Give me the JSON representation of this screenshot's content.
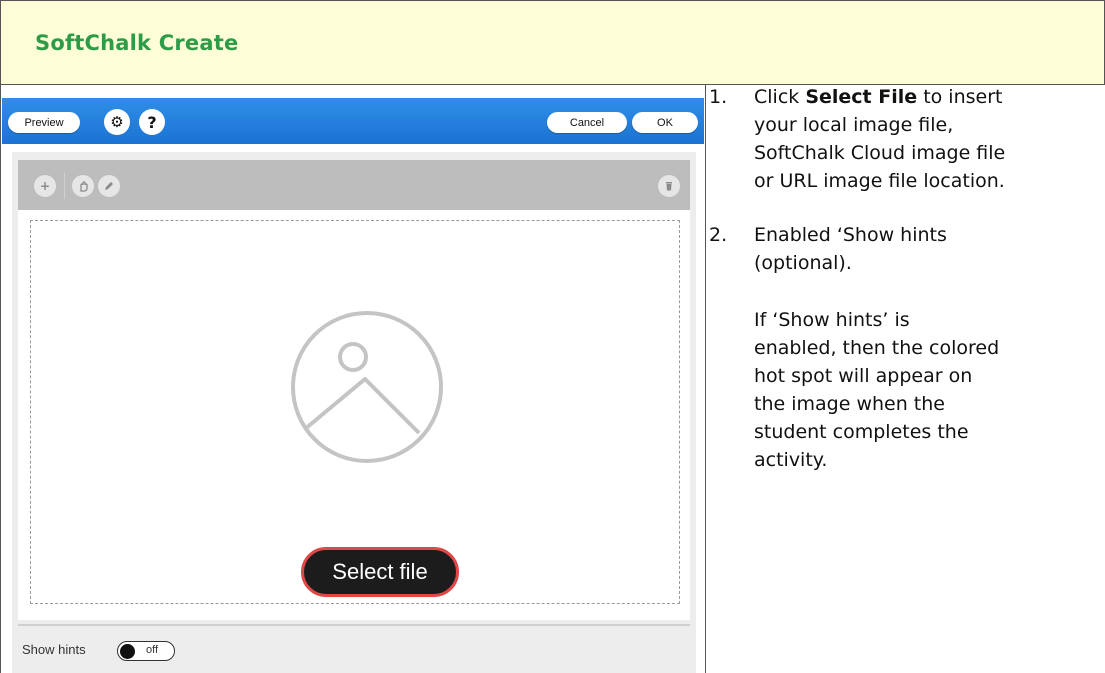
{
  "header": {
    "title": "SoftChalk Create"
  },
  "screenshot": {
    "toolbar": {
      "preview_label": "Preview",
      "cancel_label": "Cancel",
      "ok_label": "OK",
      "settings_icon": "gear-icon",
      "help_icon": "question-icon",
      "help_glyph": "?"
    },
    "edit_toolbar": {
      "icons": [
        "add-icon",
        "hand-icon",
        "pencil-icon",
        "trash-icon"
      ]
    },
    "select_file_label": "Select file",
    "show_hints": {
      "label": "Show hints",
      "state": "off"
    },
    "colors": {
      "toolbar_blue": "#1f7fdd",
      "select_file_border": "#e04848"
    }
  },
  "instructions": {
    "step1": {
      "number": "1.",
      "before": "Click ",
      "bold": "Select File",
      "after": " to insert",
      "line2": "your local image file,",
      "line3": "SoftChalk Cloud image file",
      "line4": "or URL image file location."
    },
    "step2": {
      "number": "2.",
      "line1": "Enabled ‘Show hints",
      "line2": "(optional)."
    },
    "note": {
      "line1": "If ‘Show hints’ is",
      "line2": "enabled, then the colored",
      "line3": "hot spot will appear on",
      "line4": "the image when the",
      "line5": "student completes the",
      "line6": "activity."
    }
  },
  "colors": {
    "header_bg": "#fdfdd8",
    "header_title": "#2e9c47"
  }
}
